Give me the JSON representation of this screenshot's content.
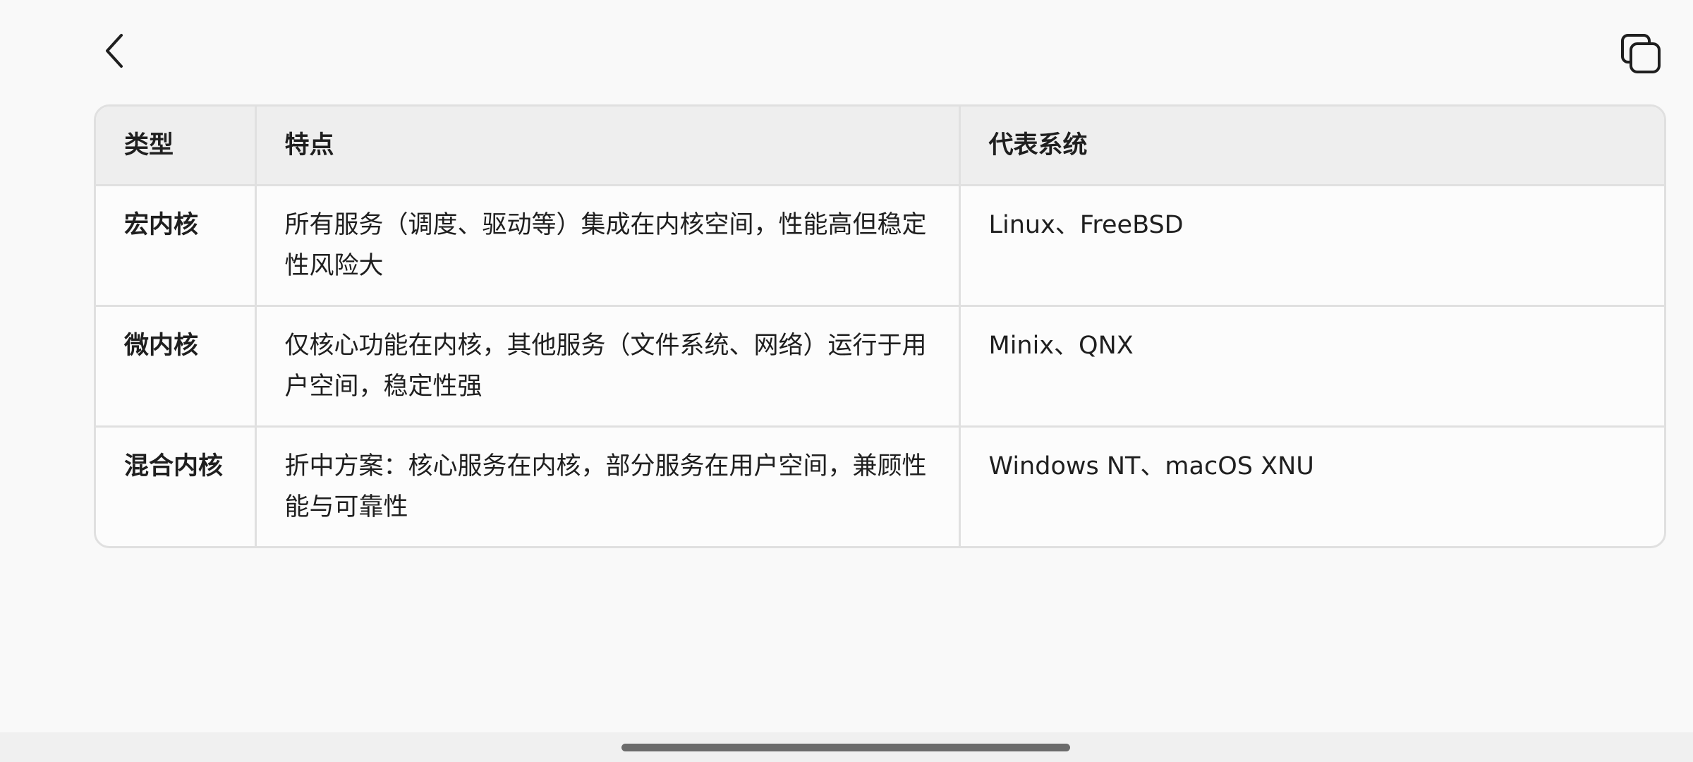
{
  "toolbar": {
    "back_icon": "chevron-left-icon",
    "copy_icon": "copy-icon"
  },
  "table": {
    "headers": [
      "类型",
      "特点",
      "代表系统"
    ],
    "rows": [
      {
        "type": "宏内核",
        "features": "所有服务（调度、驱动等）集成在内核空间，性能高但稳定性风险大",
        "systems": "Linux、FreeBSD"
      },
      {
        "type": "微内核",
        "features": "仅核心功能在内核，其他服务（文件系统、网络）运行于用户空间，稳定性强",
        "systems": "Minix、QNX"
      },
      {
        "type": "混合内核",
        "features": "折中方案：核心服务在内核，部分服务在用户空间，兼顾性能与可靠性",
        "systems": "Windows NT、macOS XNU"
      }
    ]
  },
  "colors": {
    "background": "#f9f9f9",
    "header_bg": "#eeeeee",
    "border": "#e0e0e0",
    "text": "#1f1f1f",
    "home_indicator": "#6b6b6b"
  }
}
